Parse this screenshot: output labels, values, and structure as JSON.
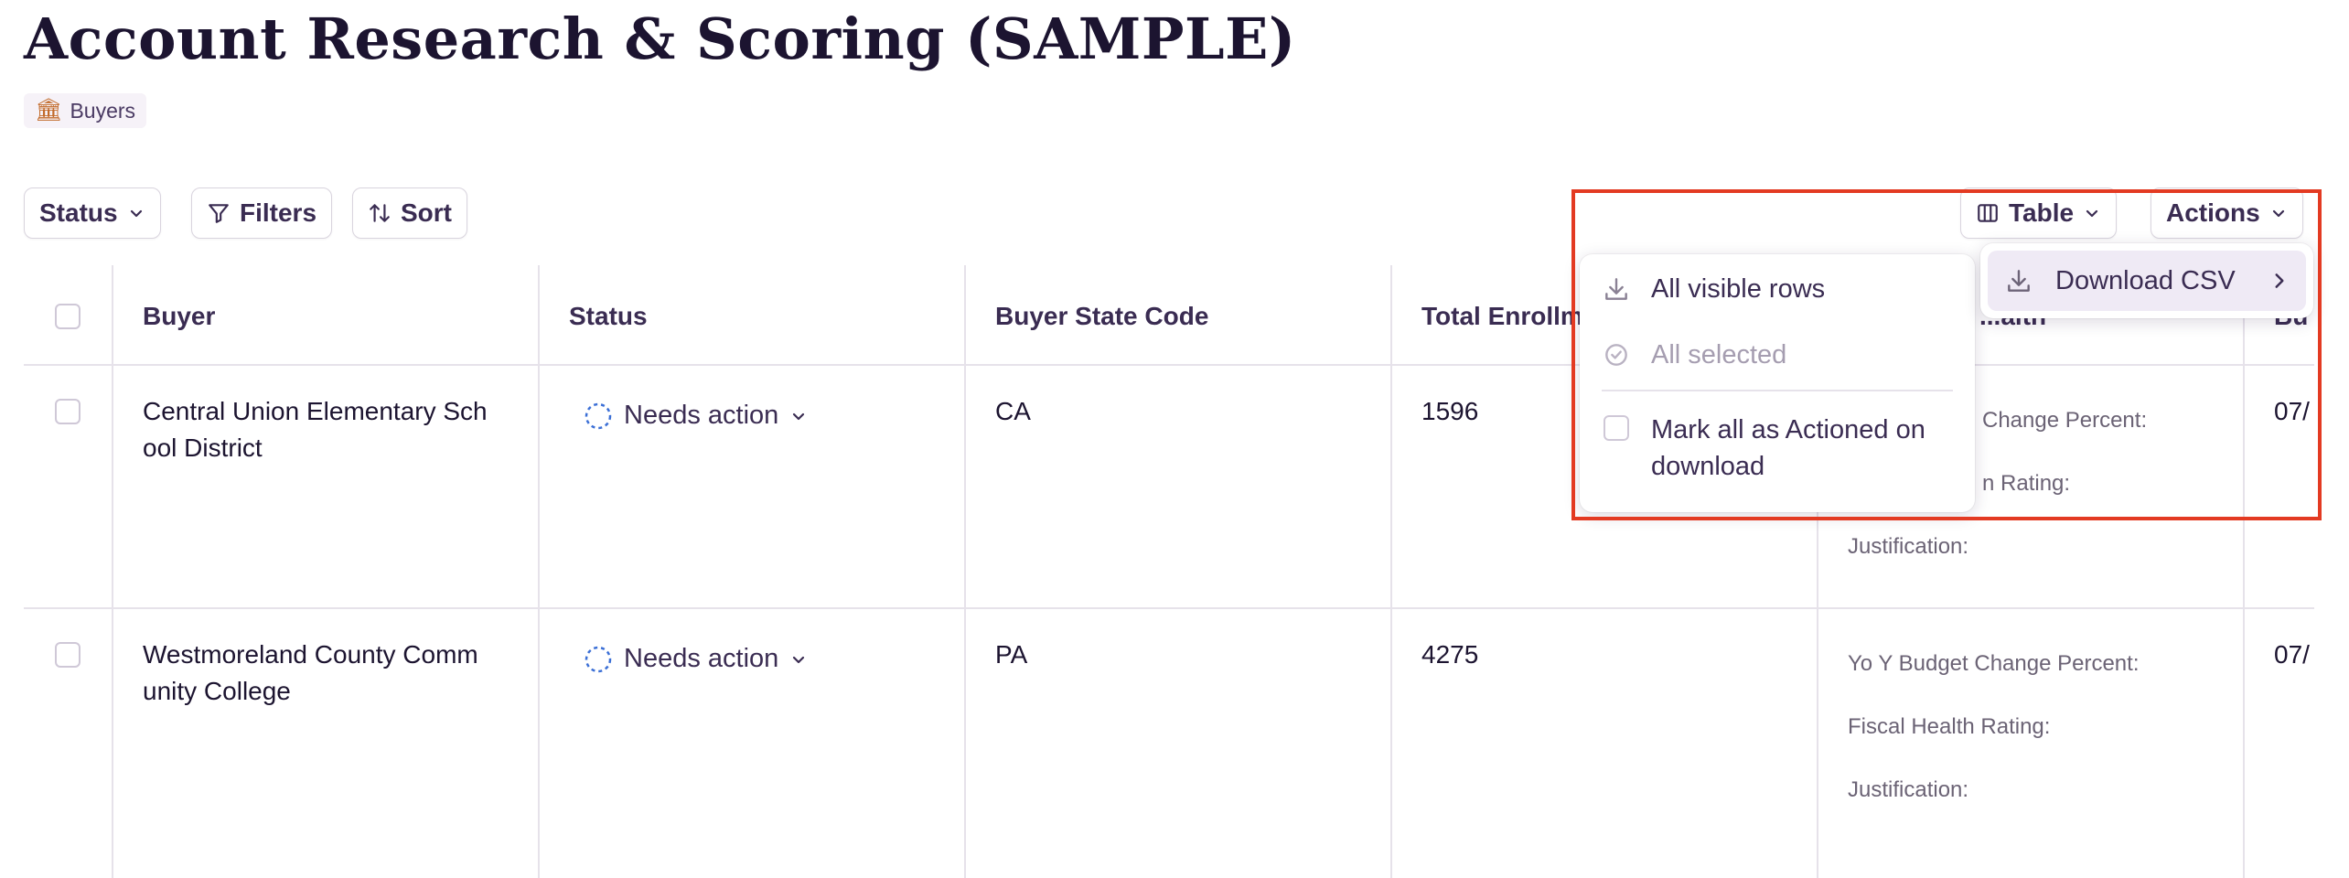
{
  "page": {
    "title": "Account Research & Scoring (SAMPLE)",
    "tag_label": "Buyers"
  },
  "toolbar": {
    "status_label": "Status",
    "filters_label": "Filters",
    "sort_label": "Sort",
    "table_label": "Table",
    "actions_label": "Actions"
  },
  "table": {
    "columns": [
      "Buyer",
      "Status",
      "Buyer State Code",
      "Total Enrollm",
      "...alth",
      "Bu"
    ],
    "rows": [
      {
        "buyer": "Central Union Elementary Sch ool District",
        "status": "Needs action",
        "state": "CA",
        "enrollment": "1596",
        "fiscal_lines": [
          "Change Percent:",
          "n Rating:",
          "Justification:"
        ],
        "date": "07/"
      },
      {
        "buyer": "Westmoreland County Comm unity College",
        "status": "Needs action",
        "state": "PA",
        "enrollment": "4275",
        "fiscal_lines": [
          "Yo Y Budget Change Percent:",
          "Fiscal Health Rating:",
          "Justification:"
        ],
        "date": "07/"
      }
    ]
  },
  "csv_menu": {
    "all_visible_rows": "All visible rows",
    "all_selected": "All selected",
    "mark_actioned": "Mark all as Actioned on download"
  },
  "actions_menu": {
    "download_csv": "Download CSV"
  },
  "colors": {
    "highlight": "#e33a22",
    "status_dashed": "#3b6fd6",
    "text": "#3a2c52"
  }
}
